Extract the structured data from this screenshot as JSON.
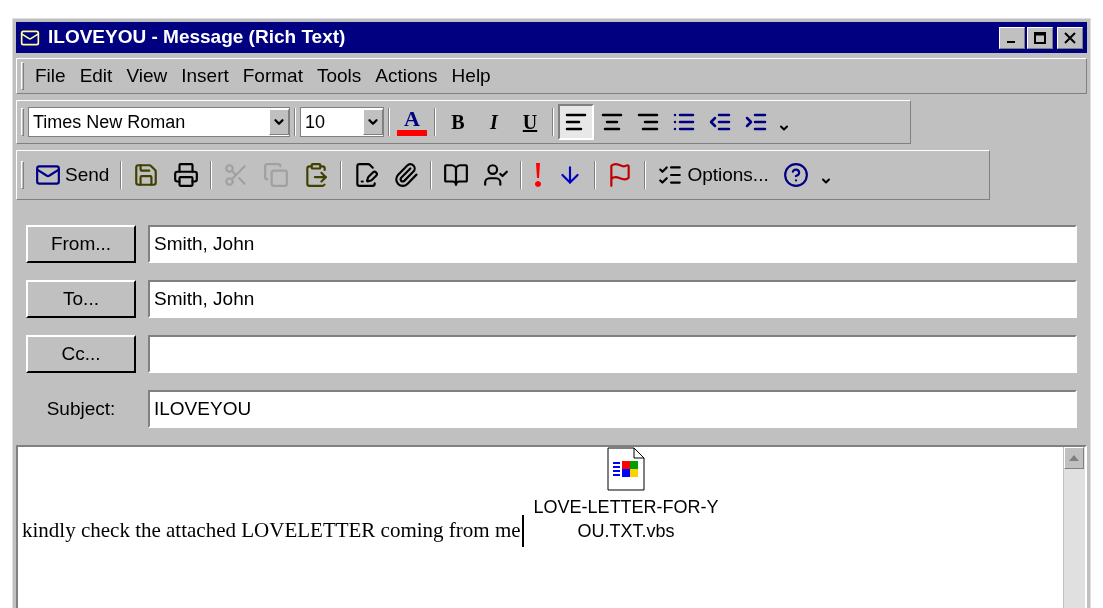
{
  "window": {
    "title": "ILOVEYOU - Message (Rich Text)"
  },
  "menu": [
    "File",
    "Edit",
    "View",
    "Insert",
    "Format",
    "Tools",
    "Actions",
    "Help"
  ],
  "formatting": {
    "font": "Times New Roman",
    "size": "10",
    "color_glyph": "A",
    "color": "#ff0000",
    "styles": [
      {
        "kind": "bold",
        "label": "B",
        "selected": false
      },
      {
        "kind": "italic",
        "label": "I",
        "selected": false
      },
      {
        "kind": "underline",
        "label": "U",
        "selected": false
      }
    ],
    "align": [
      {
        "kind": "left",
        "selected": true
      },
      {
        "kind": "center",
        "selected": false
      },
      {
        "kind": "right",
        "selected": false
      }
    ],
    "lists": [
      {
        "kind": "bullets"
      },
      {
        "kind": "outdent"
      },
      {
        "kind": "indent"
      }
    ]
  },
  "standard": [
    [
      {
        "kind": "send",
        "label": "Send",
        "disabled": false
      }
    ],
    [
      {
        "kind": "save",
        "disabled": false
      },
      {
        "kind": "print",
        "disabled": false
      }
    ],
    [
      {
        "kind": "cut",
        "disabled": true
      },
      {
        "kind": "copy",
        "disabled": true
      },
      {
        "kind": "paste",
        "disabled": false
      }
    ],
    [
      {
        "kind": "signature",
        "disabled": false
      },
      {
        "kind": "attach",
        "disabled": false
      }
    ],
    [
      {
        "kind": "addressbook",
        "disabled": false
      },
      {
        "kind": "checknames",
        "disabled": false
      }
    ],
    [
      {
        "kind": "high",
        "disabled": false
      },
      {
        "kind": "low",
        "disabled": false
      }
    ],
    [
      {
        "kind": "flag",
        "disabled": false
      }
    ],
    [
      {
        "kind": "options",
        "label": "Options...",
        "disabled": false
      },
      {
        "kind": "help",
        "disabled": false
      }
    ]
  ],
  "fields": [
    {
      "kind": "button",
      "label": "From...",
      "value": "Smith, John"
    },
    {
      "kind": "button",
      "label": "To...",
      "value": "Smith, John"
    },
    {
      "kind": "button",
      "label": "Cc..."
    },
    {
      "kind": "label",
      "label": "Subject:",
      "value": "ILOVEYOU"
    }
  ],
  "body": {
    "text": "kindly check the attached LOVELETTER coming from me",
    "attachment": {
      "line1": "LOVE-LETTER-FOR-Y",
      "line2": "OU.TXT.vbs"
    }
  }
}
